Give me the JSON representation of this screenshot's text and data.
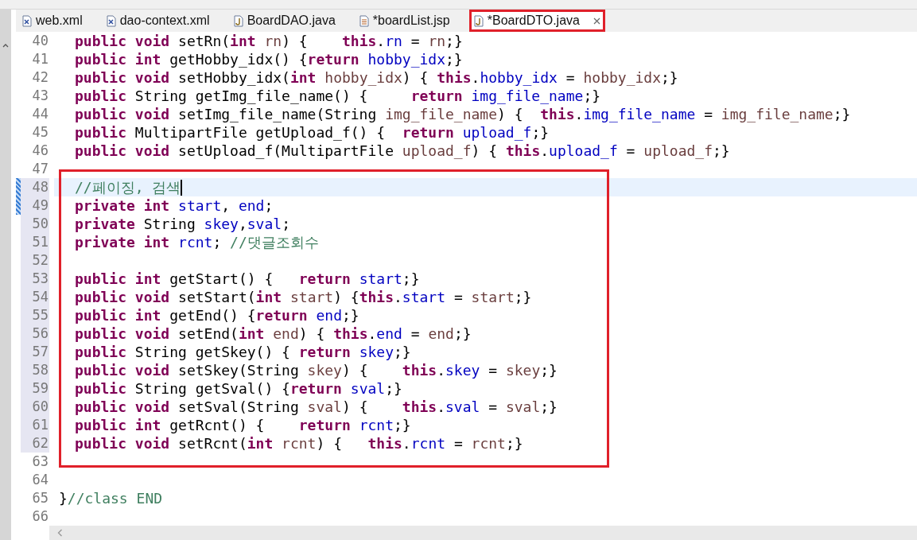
{
  "tabs": [
    {
      "label": "web.xml",
      "kind": "xml",
      "selected": false,
      "boxed": false,
      "closable": false
    },
    {
      "label": "dao-context.xml",
      "kind": "xml",
      "selected": false,
      "boxed": false,
      "closable": false
    },
    {
      "label": "BoardDAO.java",
      "kind": "java",
      "selected": false,
      "boxed": false,
      "closable": false
    },
    {
      "label": "*boardList.jsp",
      "kind": "jsp",
      "selected": false,
      "boxed": false,
      "closable": false
    },
    {
      "label": "*BoardDTO.java",
      "kind": "java",
      "selected": true,
      "boxed": true,
      "closable": true
    }
  ],
  "editor": {
    "lines": [
      {
        "n": "40",
        "indented": true,
        "current": false,
        "changed": false,
        "ranged": false,
        "boxed": false,
        "tokens": [
          {
            "kind": "kw",
            "text": "public void "
          },
          {
            "kind": "p",
            "text": "setRn("
          },
          {
            "kind": "kw",
            "text": "int "
          },
          {
            "kind": "v",
            "text": "rn"
          },
          {
            "kind": "p",
            "text": ") {    "
          },
          {
            "kind": "kw",
            "text": "this"
          },
          {
            "kind": "p",
            "text": "."
          },
          {
            "kind": "f",
            "text": "rn"
          },
          {
            "kind": "p",
            "text": " = "
          },
          {
            "kind": "v",
            "text": "rn"
          },
          {
            "kind": "p",
            "text": ";}"
          }
        ]
      },
      {
        "n": "41",
        "indented": true,
        "current": false,
        "changed": false,
        "ranged": false,
        "boxed": false,
        "tokens": [
          {
            "kind": "kw",
            "text": "public int "
          },
          {
            "kind": "p",
            "text": "getHobby_idx() {"
          },
          {
            "kind": "kw",
            "text": "return "
          },
          {
            "kind": "f",
            "text": "hobby_idx"
          },
          {
            "kind": "p",
            "text": ";}"
          }
        ]
      },
      {
        "n": "42",
        "indented": true,
        "current": false,
        "changed": false,
        "ranged": false,
        "boxed": false,
        "tokens": [
          {
            "kind": "kw",
            "text": "public void "
          },
          {
            "kind": "p",
            "text": "setHobby_idx("
          },
          {
            "kind": "kw",
            "text": "int "
          },
          {
            "kind": "v",
            "text": "hobby_idx"
          },
          {
            "kind": "p",
            "text": ") { "
          },
          {
            "kind": "kw",
            "text": "this"
          },
          {
            "kind": "p",
            "text": "."
          },
          {
            "kind": "f",
            "text": "hobby_idx"
          },
          {
            "kind": "p",
            "text": " = "
          },
          {
            "kind": "v",
            "text": "hobby_idx"
          },
          {
            "kind": "p",
            "text": ";}"
          }
        ]
      },
      {
        "n": "43",
        "indented": true,
        "current": false,
        "changed": false,
        "ranged": false,
        "boxed": false,
        "tokens": [
          {
            "kind": "kw",
            "text": "public "
          },
          {
            "kind": "p",
            "text": "String getImg_file_name() {     "
          },
          {
            "kind": "kw",
            "text": "return "
          },
          {
            "kind": "f",
            "text": "img_file_name"
          },
          {
            "kind": "p",
            "text": ";}"
          }
        ]
      },
      {
        "n": "44",
        "indented": true,
        "current": false,
        "changed": false,
        "ranged": false,
        "boxed": false,
        "tokens": [
          {
            "kind": "kw",
            "text": "public void "
          },
          {
            "kind": "p",
            "text": "setImg_file_name(String "
          },
          {
            "kind": "v",
            "text": "img_file_name"
          },
          {
            "kind": "p",
            "text": ") {  "
          },
          {
            "kind": "kw",
            "text": "this"
          },
          {
            "kind": "p",
            "text": "."
          },
          {
            "kind": "f",
            "text": "img_file_name"
          },
          {
            "kind": "p",
            "text": " = "
          },
          {
            "kind": "v",
            "text": "img_file_name"
          },
          {
            "kind": "p",
            "text": ";}"
          }
        ]
      },
      {
        "n": "45",
        "indented": true,
        "current": false,
        "changed": false,
        "ranged": false,
        "boxed": false,
        "tokens": [
          {
            "kind": "kw",
            "text": "public "
          },
          {
            "kind": "p",
            "text": "MultipartFile getUpload_f() {  "
          },
          {
            "kind": "kw",
            "text": "return "
          },
          {
            "kind": "f",
            "text": "upload_f"
          },
          {
            "kind": "p",
            "text": ";}"
          }
        ]
      },
      {
        "n": "46",
        "indented": true,
        "current": false,
        "changed": false,
        "ranged": false,
        "boxed": false,
        "tokens": [
          {
            "kind": "kw",
            "text": "public void "
          },
          {
            "kind": "p",
            "text": "setUpload_f(MultipartFile "
          },
          {
            "kind": "v",
            "text": "upload_f"
          },
          {
            "kind": "p",
            "text": ") { "
          },
          {
            "kind": "kw",
            "text": "this"
          },
          {
            "kind": "p",
            "text": "."
          },
          {
            "kind": "f",
            "text": "upload_f"
          },
          {
            "kind": "p",
            "text": " = "
          },
          {
            "kind": "v",
            "text": "upload_f"
          },
          {
            "kind": "p",
            "text": ";}"
          }
        ]
      },
      {
        "n": "47",
        "current": false,
        "changed": false,
        "ranged": false,
        "boxed": false
      },
      {
        "n": "48",
        "indented": true,
        "current": true,
        "changed": true,
        "ranged": true,
        "boxed": true,
        "tokens": [
          {
            "kind": "c",
            "text": "//페이징, 검색"
          }
        ]
      },
      {
        "n": "49",
        "indented": true,
        "current": false,
        "changed": true,
        "ranged": true,
        "boxed": true,
        "tokens": [
          {
            "kind": "kw",
            "text": "private int "
          },
          {
            "kind": "f",
            "text": "start"
          },
          {
            "kind": "p",
            "text": ", "
          },
          {
            "kind": "f",
            "text": "end"
          },
          {
            "kind": "p",
            "text": ";"
          }
        ]
      },
      {
        "n": "50",
        "indented": true,
        "current": false,
        "changed": false,
        "ranged": true,
        "boxed": true,
        "tokens": [
          {
            "kind": "kw",
            "text": "private "
          },
          {
            "kind": "p",
            "text": "String "
          },
          {
            "kind": "f",
            "text": "skey"
          },
          {
            "kind": "p",
            "text": ","
          },
          {
            "kind": "f",
            "text": "sval"
          },
          {
            "kind": "p",
            "text": ";"
          }
        ]
      },
      {
        "n": "51",
        "indented": true,
        "current": false,
        "changed": false,
        "ranged": true,
        "boxed": true,
        "tokens": [
          {
            "kind": "kw",
            "text": "private int "
          },
          {
            "kind": "f",
            "text": "rcnt"
          },
          {
            "kind": "p",
            "text": "; "
          },
          {
            "kind": "c",
            "text": "//댓글조회수"
          }
        ]
      },
      {
        "n": "52",
        "current": false,
        "changed": false,
        "ranged": true,
        "boxed": true
      },
      {
        "n": "53",
        "indented": true,
        "current": false,
        "changed": false,
        "ranged": true,
        "boxed": true,
        "tokens": [
          {
            "kind": "kw",
            "text": "public int "
          },
          {
            "kind": "p",
            "text": "getStart() {   "
          },
          {
            "kind": "kw",
            "text": "return "
          },
          {
            "kind": "f",
            "text": "start"
          },
          {
            "kind": "p",
            "text": ";}"
          }
        ]
      },
      {
        "n": "54",
        "indented": true,
        "current": false,
        "changed": false,
        "ranged": true,
        "boxed": true,
        "tokens": [
          {
            "kind": "kw",
            "text": "public void "
          },
          {
            "kind": "p",
            "text": "setStart("
          },
          {
            "kind": "kw",
            "text": "int "
          },
          {
            "kind": "v",
            "text": "start"
          },
          {
            "kind": "p",
            "text": ") {"
          },
          {
            "kind": "kw",
            "text": "this"
          },
          {
            "kind": "p",
            "text": "."
          },
          {
            "kind": "f",
            "text": "start"
          },
          {
            "kind": "p",
            "text": " = "
          },
          {
            "kind": "v",
            "text": "start"
          },
          {
            "kind": "p",
            "text": ";}"
          }
        ]
      },
      {
        "n": "55",
        "indented": true,
        "current": false,
        "changed": false,
        "ranged": true,
        "boxed": true,
        "tokens": [
          {
            "kind": "kw",
            "text": "public int "
          },
          {
            "kind": "p",
            "text": "getEnd() {"
          },
          {
            "kind": "kw",
            "text": "return "
          },
          {
            "kind": "f",
            "text": "end"
          },
          {
            "kind": "p",
            "text": ";}"
          }
        ]
      },
      {
        "n": "56",
        "indented": true,
        "current": false,
        "changed": false,
        "ranged": true,
        "boxed": true,
        "tokens": [
          {
            "kind": "kw",
            "text": "public void "
          },
          {
            "kind": "p",
            "text": "setEnd("
          },
          {
            "kind": "kw",
            "text": "int "
          },
          {
            "kind": "v",
            "text": "end"
          },
          {
            "kind": "p",
            "text": ") { "
          },
          {
            "kind": "kw",
            "text": "this"
          },
          {
            "kind": "p",
            "text": "."
          },
          {
            "kind": "f",
            "text": "end"
          },
          {
            "kind": "p",
            "text": " = "
          },
          {
            "kind": "v",
            "text": "end"
          },
          {
            "kind": "p",
            "text": ";}"
          }
        ]
      },
      {
        "n": "57",
        "indented": true,
        "current": false,
        "changed": false,
        "ranged": true,
        "boxed": true,
        "tokens": [
          {
            "kind": "kw",
            "text": "public "
          },
          {
            "kind": "p",
            "text": "String getSkey() { "
          },
          {
            "kind": "kw",
            "text": "return "
          },
          {
            "kind": "f",
            "text": "skey"
          },
          {
            "kind": "p",
            "text": ";}"
          }
        ]
      },
      {
        "n": "58",
        "indented": true,
        "current": false,
        "changed": false,
        "ranged": true,
        "boxed": true,
        "tokens": [
          {
            "kind": "kw",
            "text": "public void "
          },
          {
            "kind": "p",
            "text": "setSkey(String "
          },
          {
            "kind": "v",
            "text": "skey"
          },
          {
            "kind": "p",
            "text": ") {    "
          },
          {
            "kind": "kw",
            "text": "this"
          },
          {
            "kind": "p",
            "text": "."
          },
          {
            "kind": "f",
            "text": "skey"
          },
          {
            "kind": "p",
            "text": " = "
          },
          {
            "kind": "v",
            "text": "skey"
          },
          {
            "kind": "p",
            "text": ";}"
          }
        ]
      },
      {
        "n": "59",
        "indented": true,
        "current": false,
        "changed": false,
        "ranged": true,
        "boxed": true,
        "tokens": [
          {
            "kind": "kw",
            "text": "public "
          },
          {
            "kind": "p",
            "text": "String getSval() {"
          },
          {
            "kind": "kw",
            "text": "return "
          },
          {
            "kind": "f",
            "text": "sval"
          },
          {
            "kind": "p",
            "text": ";}"
          }
        ]
      },
      {
        "n": "60",
        "indented": true,
        "current": false,
        "changed": false,
        "ranged": true,
        "boxed": true,
        "tokens": [
          {
            "kind": "kw",
            "text": "public void "
          },
          {
            "kind": "p",
            "text": "setSval(String "
          },
          {
            "kind": "v",
            "text": "sval"
          },
          {
            "kind": "p",
            "text": ") {    "
          },
          {
            "kind": "kw",
            "text": "this"
          },
          {
            "kind": "p",
            "text": "."
          },
          {
            "kind": "f",
            "text": "sval"
          },
          {
            "kind": "p",
            "text": " = "
          },
          {
            "kind": "v",
            "text": "sval"
          },
          {
            "kind": "p",
            "text": ";}"
          }
        ]
      },
      {
        "n": "61",
        "indented": true,
        "current": false,
        "changed": false,
        "ranged": true,
        "boxed": true,
        "tokens": [
          {
            "kind": "kw",
            "text": "public int "
          },
          {
            "kind": "p",
            "text": "getRcnt() {    "
          },
          {
            "kind": "kw",
            "text": "return "
          },
          {
            "kind": "f",
            "text": "rcnt"
          },
          {
            "kind": "p",
            "text": ";}"
          }
        ]
      },
      {
        "n": "62",
        "indented": true,
        "current": false,
        "changed": false,
        "ranged": true,
        "boxed": true,
        "tokens": [
          {
            "kind": "kw",
            "text": "public void "
          },
          {
            "kind": "p",
            "text": "setRcnt("
          },
          {
            "kind": "kw",
            "text": "int "
          },
          {
            "kind": "v",
            "text": "rcnt"
          },
          {
            "kind": "p",
            "text": ") {   "
          },
          {
            "kind": "kw",
            "text": "this"
          },
          {
            "kind": "p",
            "text": "."
          },
          {
            "kind": "f",
            "text": "rcnt"
          },
          {
            "kind": "p",
            "text": " = "
          },
          {
            "kind": "v",
            "text": "rcnt"
          },
          {
            "kind": "p",
            "text": ";}"
          }
        ]
      },
      {
        "n": "63",
        "current": false,
        "changed": false,
        "ranged": false,
        "boxed": true
      },
      {
        "n": "64",
        "current": false,
        "changed": false,
        "ranged": false,
        "boxed": false
      },
      {
        "n": "65",
        "indented": false,
        "current": false,
        "changed": false,
        "ranged": false,
        "boxed": false,
        "tokens": [
          {
            "kind": "p",
            "text": "}"
          },
          {
            "kind": "c",
            "text": "//class END"
          }
        ]
      },
      {
        "n": "66",
        "current": false,
        "changed": false,
        "ranged": false,
        "boxed": false
      }
    ]
  }
}
